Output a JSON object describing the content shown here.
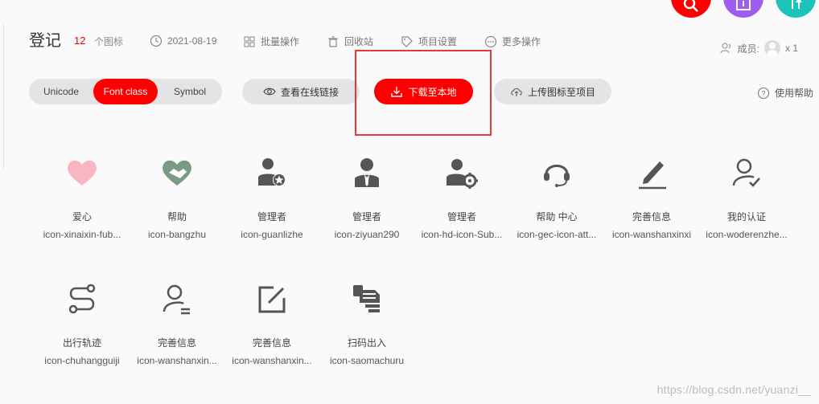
{
  "colors": {
    "accent": "#ff0000",
    "highlight_box": "#e23a3a",
    "fab_search": "#ff0000",
    "fab_upload": "#a05cf0",
    "fab_teal": "#1cc3b8"
  },
  "header": {
    "title": "登记",
    "count": "12",
    "count_unit": "个图标",
    "date": "2021-08-19",
    "batch_ops": "批量操作",
    "recycle": "回收站",
    "project_settings": "项目设置",
    "more_ops": "更多操作",
    "members_label": "成员:",
    "members_count": "x 1"
  },
  "toolbar": {
    "tabs": [
      {
        "label": "Unicode",
        "active": false
      },
      {
        "label": "Font class",
        "active": true
      },
      {
        "label": "Symbol",
        "active": false
      }
    ],
    "view_link": "查看在线链接",
    "download": "下载至本地",
    "upload": "上传图标至项目",
    "help": "使用帮助"
  },
  "icons": [
    {
      "name": "爱心",
      "code": "icon-xinaixin-fub...",
      "icon": "heart-icon"
    },
    {
      "name": "帮助",
      "code": "icon-bangzhu",
      "icon": "handshake-icon"
    },
    {
      "name": "管理者",
      "code": "icon-guanlizhe",
      "icon": "manager-star-icon"
    },
    {
      "name": "管理者",
      "code": "icon-ziyuan290",
      "icon": "manager-suit-icon"
    },
    {
      "name": "管理者",
      "code": "icon-hd-icon-Sub...",
      "icon": "manager-gear-icon"
    },
    {
      "name": "帮助 中心",
      "code": "icon-gec-icon-att...",
      "icon": "headset-icon"
    },
    {
      "name": "完善信息",
      "code": "icon-wanshanxinxi",
      "icon": "pen-line-icon"
    },
    {
      "name": "我的认证",
      "code": "icon-woderenzhe...",
      "icon": "user-check-icon"
    },
    {
      "name": "出行轨迹",
      "code": "icon-chuhangguiji",
      "icon": "route-icon"
    },
    {
      "name": "完善信息",
      "code": "icon-wanshanxin...",
      "icon": "user-minus-icon"
    },
    {
      "name": "完善信息",
      "code": "icon-wanshanxin...",
      "icon": "edit-square-icon"
    },
    {
      "name": "扫码出入",
      "code": "icon-saomachuru",
      "icon": "scan-list-icon"
    }
  ],
  "watermark": "https://blog.csdn.net/yuanzi__"
}
